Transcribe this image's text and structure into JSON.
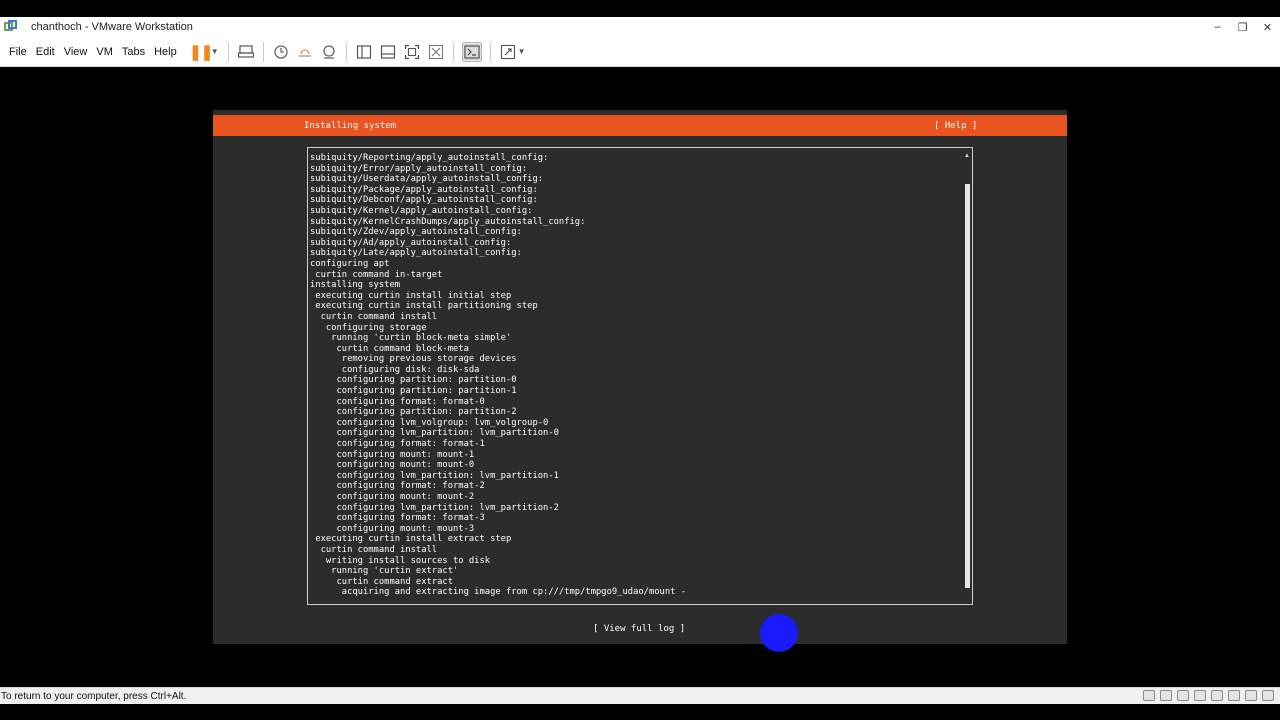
{
  "window": {
    "title": "chanthoch - VMware Workstation",
    "minimize": "–",
    "restore": "❐",
    "close": "✕"
  },
  "menu": {
    "items": [
      "File",
      "Edit",
      "View",
      "VM",
      "Tabs",
      "Help"
    ]
  },
  "toolbar": {
    "icons": [
      "pause-icon",
      "send-keys-icon",
      "snapshot-icon",
      "revert-snapshot-icon",
      "snapshot-manager-icon",
      "library-icon",
      "thumbnail-icon",
      "full-screen-icon",
      "unity-icon",
      "console-icon",
      "stretch-icon"
    ]
  },
  "installer": {
    "title": "Installing system",
    "help": "[ Help ]",
    "view_full_log": "[ View full log ]",
    "header_color": "#e95420",
    "log_lines": [
      "subiquity/Reporting/apply_autoinstall_config:",
      "subiquity/Error/apply_autoinstall_config:",
      "subiquity/Userdata/apply_autoinstall_config:",
      "subiquity/Package/apply_autoinstall_config:",
      "subiquity/Debconf/apply_autoinstall_config:",
      "subiquity/Kernel/apply_autoinstall_config:",
      "subiquity/KernelCrashDumps/apply_autoinstall_config:",
      "subiquity/Zdev/apply_autoinstall_config:",
      "subiquity/Ad/apply_autoinstall_config:",
      "subiquity/Late/apply_autoinstall_config:",
      "configuring apt",
      " curtin command in-target",
      "installing system",
      " executing curtin install initial step",
      " executing curtin install partitioning step",
      "  curtin command install",
      "   configuring storage",
      "    running 'curtin block-meta simple'",
      "     curtin command block-meta",
      "      removing previous storage devices",
      "      configuring disk: disk-sda",
      "     configuring partition: partition-0",
      "     configuring partition: partition-1",
      "     configuring format: format-0",
      "     configuring partition: partition-2",
      "     configuring lvm_volgroup: lvm_volgroup-0",
      "     configuring lvm_partition: lvm_partition-0",
      "     configuring format: format-1",
      "     configuring mount: mount-1",
      "     configuring mount: mount-0",
      "     configuring lvm_partition: lvm_partition-1",
      "     configuring format: format-2",
      "     configuring mount: mount-2",
      "     configuring lvm_partition: lvm_partition-2",
      "     configuring format: format-3",
      "     configuring mount: mount-3",
      " executing curtin install extract step",
      "  curtin command install",
      "   writing install sources to disk",
      "    running 'curtin extract'",
      "     curtin command extract",
      "      acquiring and extracting image from cp:///tmp/tmpgo9_udao/mount -"
    ]
  },
  "statusbar": {
    "message": "To return to your computer, press Ctrl+Alt."
  }
}
